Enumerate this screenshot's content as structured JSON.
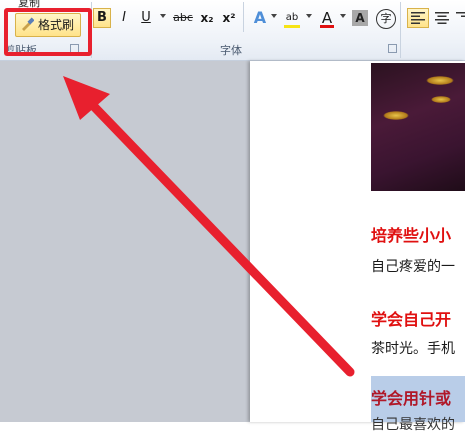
{
  "ribbon": {
    "copy_label": "复制",
    "format_painter_label": "格式刷",
    "clipboard_group": "剪贴板",
    "font_group": "字体",
    "buttons": {
      "bold": "B",
      "italic": "I",
      "underline": "U",
      "strike": "abc",
      "subscript": "x₂",
      "superscript": "x²",
      "text_effect": "A",
      "highlight": "ab",
      "font_color": "A",
      "char_shading": "A",
      "phonetic": "字"
    }
  },
  "document": {
    "heading1": "培养些小小",
    "text1": "自己疼爱的一",
    "heading2": "学会自己开",
    "text2": "茶时光。手机",
    "heading3": "学会用针或",
    "text3": "自己最喜欢的"
  },
  "colors": {
    "annotation": "#e8202e",
    "heading": "#e01010"
  }
}
